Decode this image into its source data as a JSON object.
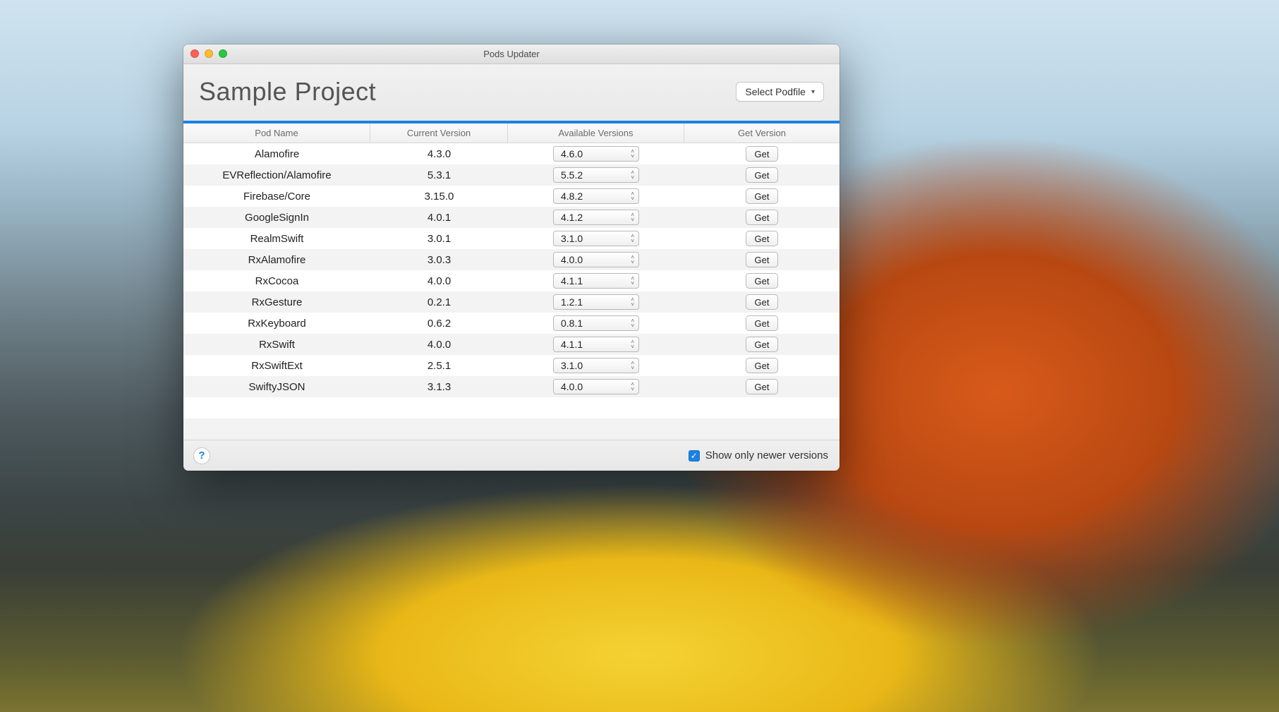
{
  "window": {
    "title": "Pods Updater",
    "project_name": "Sample Project",
    "select_podfile_label": "Select Podfile"
  },
  "columns": {
    "name": "Pod Name",
    "current": "Current Version",
    "available": "Available Versions",
    "get": "Get Version"
  },
  "get_button_label": "Get",
  "rows": [
    {
      "name": "Alamofire",
      "current": "4.3.0",
      "available": "4.6.0"
    },
    {
      "name": "EVReflection/Alamofire",
      "current": "5.3.1",
      "available": "5.5.2"
    },
    {
      "name": "Firebase/Core",
      "current": "3.15.0",
      "available": "4.8.2"
    },
    {
      "name": "GoogleSignIn",
      "current": "4.0.1",
      "available": "4.1.2"
    },
    {
      "name": "RealmSwift",
      "current": "3.0.1",
      "available": "3.1.0"
    },
    {
      "name": "RxAlamofire",
      "current": "3.0.3",
      "available": "4.0.0"
    },
    {
      "name": "RxCocoa",
      "current": "4.0.0",
      "available": "4.1.1"
    },
    {
      "name": "RxGesture",
      "current": "0.2.1",
      "available": "1.2.1"
    },
    {
      "name": "RxKeyboard",
      "current": "0.6.2",
      "available": "0.8.1"
    },
    {
      "name": "RxSwift",
      "current": "4.0.0",
      "available": "4.1.1"
    },
    {
      "name": "RxSwiftExt",
      "current": "2.5.1",
      "available": "3.1.0"
    },
    {
      "name": "SwiftyJSON",
      "current": "3.1.3",
      "available": "4.0.0"
    }
  ],
  "empty_rows": 2,
  "status": {
    "help_symbol": "?",
    "checkbox_label": "Show only newer versions",
    "checkbox_checked": true
  }
}
